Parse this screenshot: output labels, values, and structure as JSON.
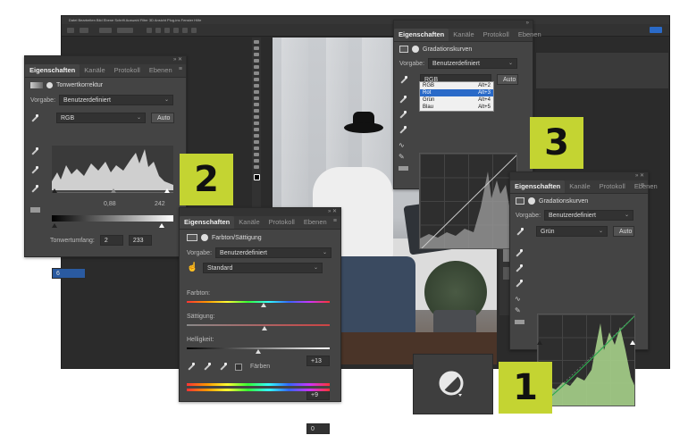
{
  "badges": {
    "one": "1",
    "two": "2",
    "three": "3"
  },
  "photoshop": {
    "menu": "Datei  Bearbeiten  Bild  Ebene  Schrift  Auswahl  Filter  3D  Ansicht  Plug-ins  Fenster  Hilfe"
  },
  "levels_panel": {
    "tabs": [
      "Eigenschaften",
      "Kanäle",
      "Protokoll",
      "Ebenen"
    ],
    "title": "Tonwertkorrektur",
    "preset_label": "Vorgabe:",
    "preset_value": "Benutzerdefiniert",
    "channel": "RGB",
    "auto_label": "Auto",
    "input_black": "6",
    "input_gamma": "0,88",
    "input_white": "242",
    "output_label": "Tonwertumfang:",
    "output_black": "2",
    "output_white": "233"
  },
  "hue_panel": {
    "tabs": [
      "Eigenschaften",
      "Kanäle",
      "Protokoll",
      "Ebenen"
    ],
    "title": "Farbton/Sättigung",
    "preset_label": "Vorgabe:",
    "preset_value": "Benutzerdefiniert",
    "range": "Standard",
    "hue_label": "Farbton:",
    "hue_value": "+13",
    "hue_level": 0.536,
    "sat_label": "Sättigung:",
    "sat_value": "+9",
    "sat_level": 0.545,
    "light_label": "Helligkeit:",
    "light_value": "0",
    "light_level": 0.5,
    "colorize_label": "Färben"
  },
  "curves_top": {
    "tabs": [
      "Eigenschaften",
      "Kanäle",
      "Protokoll",
      "Ebenen"
    ],
    "title": "Gradationskurven",
    "preset_label": "Vorgabe:",
    "preset_value": "Benutzerdefiniert",
    "channel": "RGB",
    "auto_label": "Auto",
    "dropdown": [
      {
        "name": "RGB",
        "shortcut": "Alt+2"
      },
      {
        "name": "Rot",
        "shortcut": "Alt+3"
      },
      {
        "name": "Grün",
        "shortcut": "Alt+4"
      },
      {
        "name": "Blau",
        "shortcut": "Alt+5"
      }
    ],
    "selected_index": 1
  },
  "curves_green": {
    "tabs": [
      "Eigenschaften",
      "Kanäle",
      "Protokoll",
      "Ebenen"
    ],
    "title": "Gradationskurven",
    "preset_label": "Vorgabe:",
    "preset_value": "Benutzerdefiniert",
    "channel": "Grün",
    "auto_label": "Auto"
  }
}
